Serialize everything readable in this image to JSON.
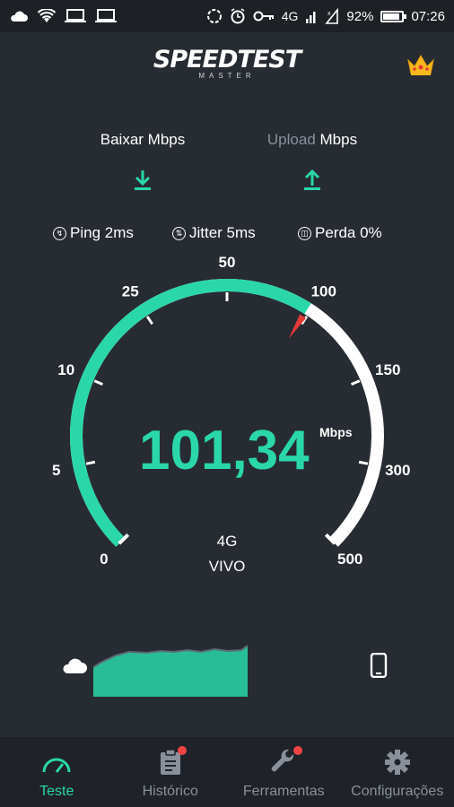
{
  "status_bar": {
    "network_type": "4G",
    "battery_percent": "92%",
    "battery_level": 0.92,
    "time": "07:26"
  },
  "header": {
    "logo_main": "SPEEDTEST",
    "logo_sub": "MASTER",
    "crown_icon": "crown-icon"
  },
  "speeds": {
    "download_label": "Baixar Mbps",
    "upload_word": "Upload",
    "upload_unit": "Mbps",
    "download_icon": "download-arrow-icon",
    "upload_icon": "upload-arrow-icon"
  },
  "metrics": {
    "ping": "Ping 2ms",
    "jitter": "Jitter 5ms",
    "loss": "Perda 0%"
  },
  "gauge": {
    "ticks": [
      "0",
      "5",
      "10",
      "25",
      "50",
      "100",
      "150",
      "300",
      "500"
    ],
    "value": "101,34",
    "unit": "Mbps",
    "network": "4G",
    "carrier": "VIVO",
    "fill_fraction": 0.62,
    "colors": {
      "fill": "#2ad7a8",
      "track": "#ffffff",
      "needle": "#e53935"
    }
  },
  "nav": {
    "items": [
      {
        "label": "Teste",
        "icon": "speedometer-icon",
        "active": true
      },
      {
        "label": "Histórico",
        "icon": "clipboard-icon",
        "badge": true
      },
      {
        "label": "Ferramentas",
        "icon": "wrench-icon",
        "badge": true
      },
      {
        "label": "Configurações",
        "icon": "gear-icon"
      }
    ]
  }
}
